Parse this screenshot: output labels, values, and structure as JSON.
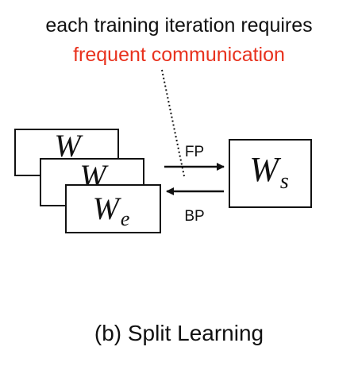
{
  "headline": {
    "line1": "each training iteration requires",
    "line2": "frequent communication"
  },
  "client_models": {
    "back_label": "W",
    "middle_label": "W",
    "front_label": "W",
    "front_subscript": "e"
  },
  "server_model": {
    "label": "W",
    "subscript": "s"
  },
  "arrows": {
    "forward_label": "FP",
    "backward_label": "BP"
  },
  "caption": "(b) Split Learning",
  "colors": {
    "highlight": "#e8321e",
    "ink": "#111111"
  }
}
